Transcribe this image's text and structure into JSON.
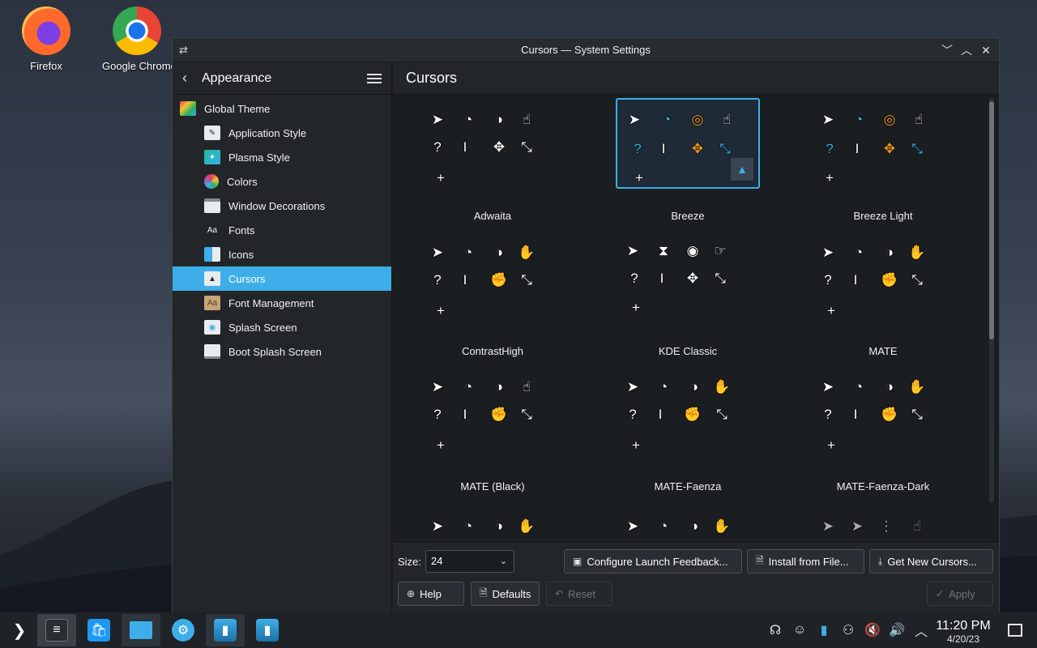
{
  "desktop": {
    "icons": [
      {
        "label": "Firefox",
        "icon": "firefox-icon"
      },
      {
        "label": "Google Chrome",
        "icon": "chrome-icon"
      }
    ]
  },
  "window": {
    "title": "Cursors — System Settings",
    "buttons": {
      "minimize": "﹀",
      "maximize": "︿",
      "close": "✕"
    }
  },
  "sidebar": {
    "back_label": "Appearance",
    "items": [
      {
        "label": "Global Theme",
        "icon": "global-theme-icon",
        "level": "top"
      },
      {
        "label": "Application Style",
        "icon": "application-style-icon",
        "level": "sub"
      },
      {
        "label": "Plasma Style",
        "icon": "plasma-style-icon",
        "level": "sub"
      },
      {
        "label": "Colors",
        "icon": "colors-icon",
        "level": "sub"
      },
      {
        "label": "Window Decorations",
        "icon": "window-decorations-icon",
        "level": "sub"
      },
      {
        "label": "Fonts",
        "icon": "fonts-icon",
        "level": "sub"
      },
      {
        "label": "Icons",
        "icon": "icons-icon",
        "level": "sub"
      },
      {
        "label": "Cursors",
        "icon": "cursors-icon",
        "level": "sub",
        "active": true
      },
      {
        "label": "Font Management",
        "icon": "font-management-icon",
        "level": "sub"
      },
      {
        "label": "Splash Screen",
        "icon": "splash-screen-icon",
        "level": "sub"
      },
      {
        "label": "Boot Splash Screen",
        "icon": "boot-splash-screen-icon",
        "level": "sub"
      }
    ]
  },
  "main": {
    "title": "Cursors",
    "themes": [
      {
        "name": "Adwaita"
      },
      {
        "name": "Breeze",
        "selected": true
      },
      {
        "name": "Breeze Light"
      },
      {
        "name": "ContrastHigh"
      },
      {
        "name": "KDE Classic"
      },
      {
        "name": "MATE"
      },
      {
        "name": "MATE (Black)"
      },
      {
        "name": "MATE-Faenza"
      },
      {
        "name": "MATE-Faenza-Dark"
      }
    ]
  },
  "footer": {
    "size_label": "Size:",
    "size_value": "24",
    "configure_label": "Configure Launch Feedback...",
    "install_label": "Install from File...",
    "get_new_label": "Get New Cursors...",
    "help_label": "Help",
    "defaults_label": "Defaults",
    "reset_label": "Reset",
    "apply_label": "Apply"
  },
  "taskbar": {
    "clock_time": "11:20 PM",
    "clock_date": "4/20/23"
  },
  "colors": {
    "accent": "#3daee9",
    "window_bg": "#1b1e20",
    "sidebar_bg": "#232629"
  }
}
